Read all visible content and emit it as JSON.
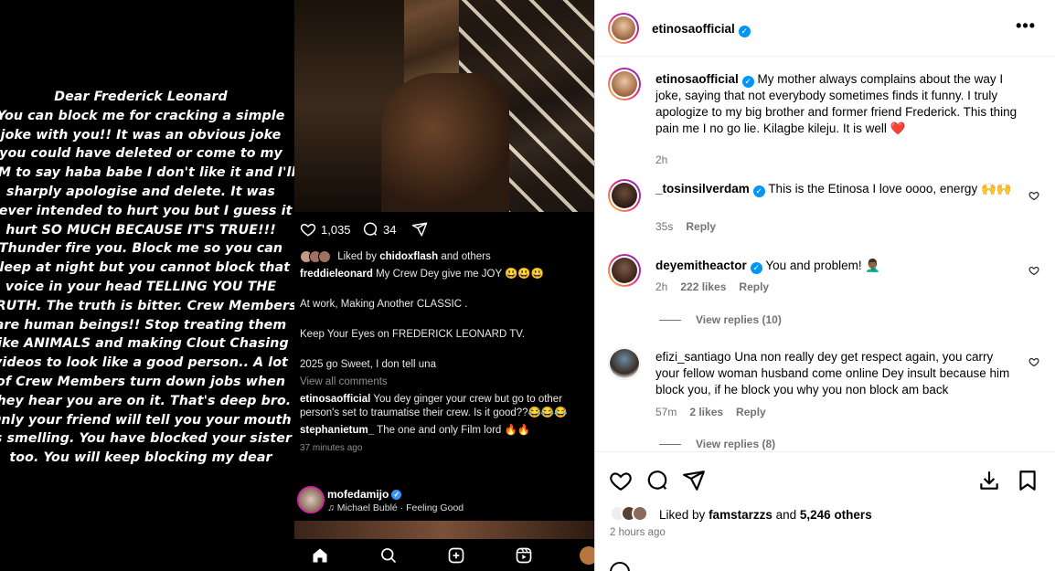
{
  "story": {
    "lines": [
      "Dear Frederick Leonard",
      "You can block me for cracking a simple",
      "joke with you!! It was an obvious joke",
      "you could have deleted or come to my",
      "DM to say haba babe I don't like it and I'll",
      "sharply apologise and delete. It was",
      "never intended to hurt you but I guess it",
      "hurt SO MUCH BECAUSE IT'S TRUE!!!",
      "Thunder fire you. Block me so you can",
      "sleep at night but you cannot block that",
      "voice in your head TELLING YOU THE",
      "TRUTH. The truth is bitter. Crew Members",
      "are human beings!! Stop treating them",
      "like ANIMALS and making Clout Chasing",
      "videos to look like a good person.. A lot",
      "of Crew Members turn down jobs when",
      "they hear you are on it. That's deep bro.",
      "Only your friend will tell you your mouth",
      "is smelling. You have blocked your sister",
      "too. You will keep blocking my dear"
    ]
  },
  "middle": {
    "like_count": "1,035",
    "comment_count": "34",
    "liked_by_prefix": "Liked by",
    "liked_by_user": "chidoxflash",
    "liked_by_suffix": "and others",
    "caption_user": "freddieleonard",
    "caption_text": "My Crew Dey give me JOY 😃😃😃",
    "line2": "At work, Making Another CLASSIC .",
    "line3": "Keep Your Eyes on FREDERICK LEONARD TV.",
    "line4": "2025 go Sweet, I don tell una",
    "view_all": "View all comments",
    "c1_user": "etinosaofficial",
    "c1_text": "You dey ginger your crew but go to other person's set to traumatise their crew. Is it good??😂😂😂",
    "c2_user": "stephanietum_",
    "c2_text": "The one and only Film lord 🔥🔥",
    "time": "37 minutes ago",
    "profile_name": "mofedamijo",
    "song": "♫ Michael Bublé · Feeling Good"
  },
  "right": {
    "header_user": "etinosaofficial",
    "more": "•••",
    "caption": {
      "user": "etinosaofficial",
      "text": "My mother always complains about the way I joke, saying that not everybody sometimes finds it funny. I truly apologize to my big brother and former friend Frederick. This thing pain me I no go lie. Kilagbe kileju. It is well ❤️",
      "time": "2h"
    },
    "comments": [
      {
        "user": "_tosinsilverdam",
        "text": "This is the Etinosa I love oooo, energy 🙌🙌",
        "time": "35s",
        "likes": "",
        "reply": "Reply"
      },
      {
        "user": "deyemitheactor",
        "text": "You and problem! 🤦🏾‍♂️",
        "time": "2h",
        "likes": "222 likes",
        "reply": "Reply",
        "view_replies": "View replies (10)"
      },
      {
        "user": "efizi_santiago",
        "text": "Una non really dey get respect again, you carry your fellow woman husband come online Dey insult because him block you, if he block you why you non block am back",
        "time": "57m",
        "likes": "2 likes",
        "reply": "Reply",
        "view_replies": "View replies (8)"
      }
    ],
    "likes_prefix": "Liked by",
    "likes_user": "famstarzzs",
    "likes_and": "and",
    "likes_others": "5,246 others",
    "post_time": "2 hours ago"
  },
  "colors": {
    "verified": "#0095f6",
    "heart_red": "#ed4956",
    "muted": "#737373"
  }
}
